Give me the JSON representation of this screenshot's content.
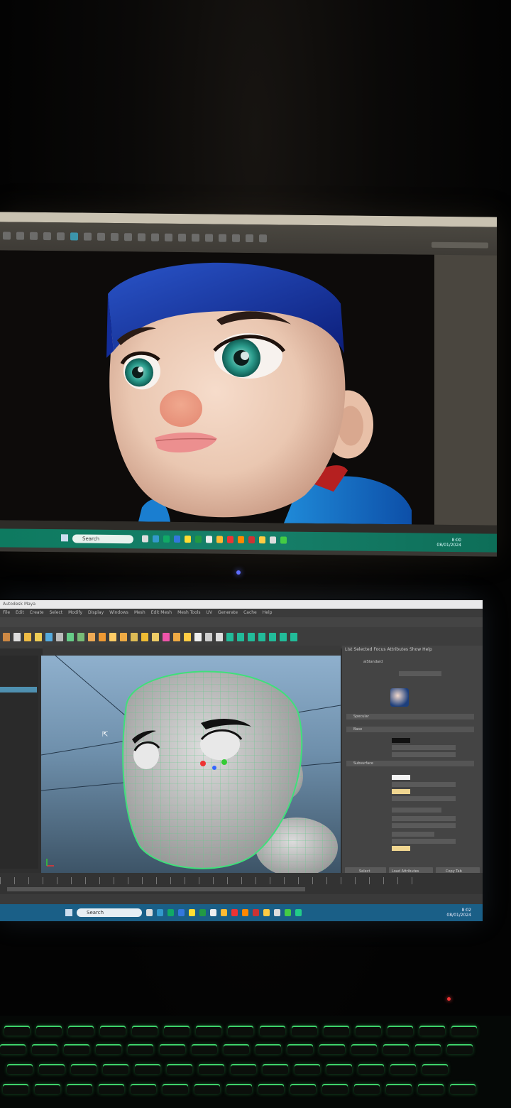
{
  "scene": "photo of two computer monitors and a backlit keyboard",
  "top_monitor": {
    "taskbar": {
      "search_placeholder": "Search",
      "clock_time": "8:00",
      "clock_date": "08/01/2024"
    },
    "accent_color": "#17806a"
  },
  "bottom_monitor": {
    "title_bar": "Autodesk Maya",
    "menu": [
      "File",
      "Edit",
      "Create",
      "Select",
      "Modify",
      "Display",
      "Windows",
      "Mesh",
      "Edit Mesh",
      "Mesh Tools",
      "UV",
      "Generate",
      "Cache",
      "Help"
    ],
    "attribute_editor": {
      "tabs": [
        "List",
        "Selected",
        "Focus",
        "Attributes",
        "Show",
        "Help"
      ],
      "material_name": "aiStandard",
      "section_base": "Base",
      "section_specular": "Specular",
      "section_subsurface": "Subsurface",
      "buttons": [
        "Select",
        "Load Attributes",
        "Copy Tab"
      ]
    },
    "taskbar": {
      "search_placeholder": "Search",
      "clock_time": "8:02",
      "clock_date": "08/01/2024"
    },
    "accent_color": "#1a5f87"
  },
  "keyboard": {
    "backlight_color": "#3dd26a"
  }
}
